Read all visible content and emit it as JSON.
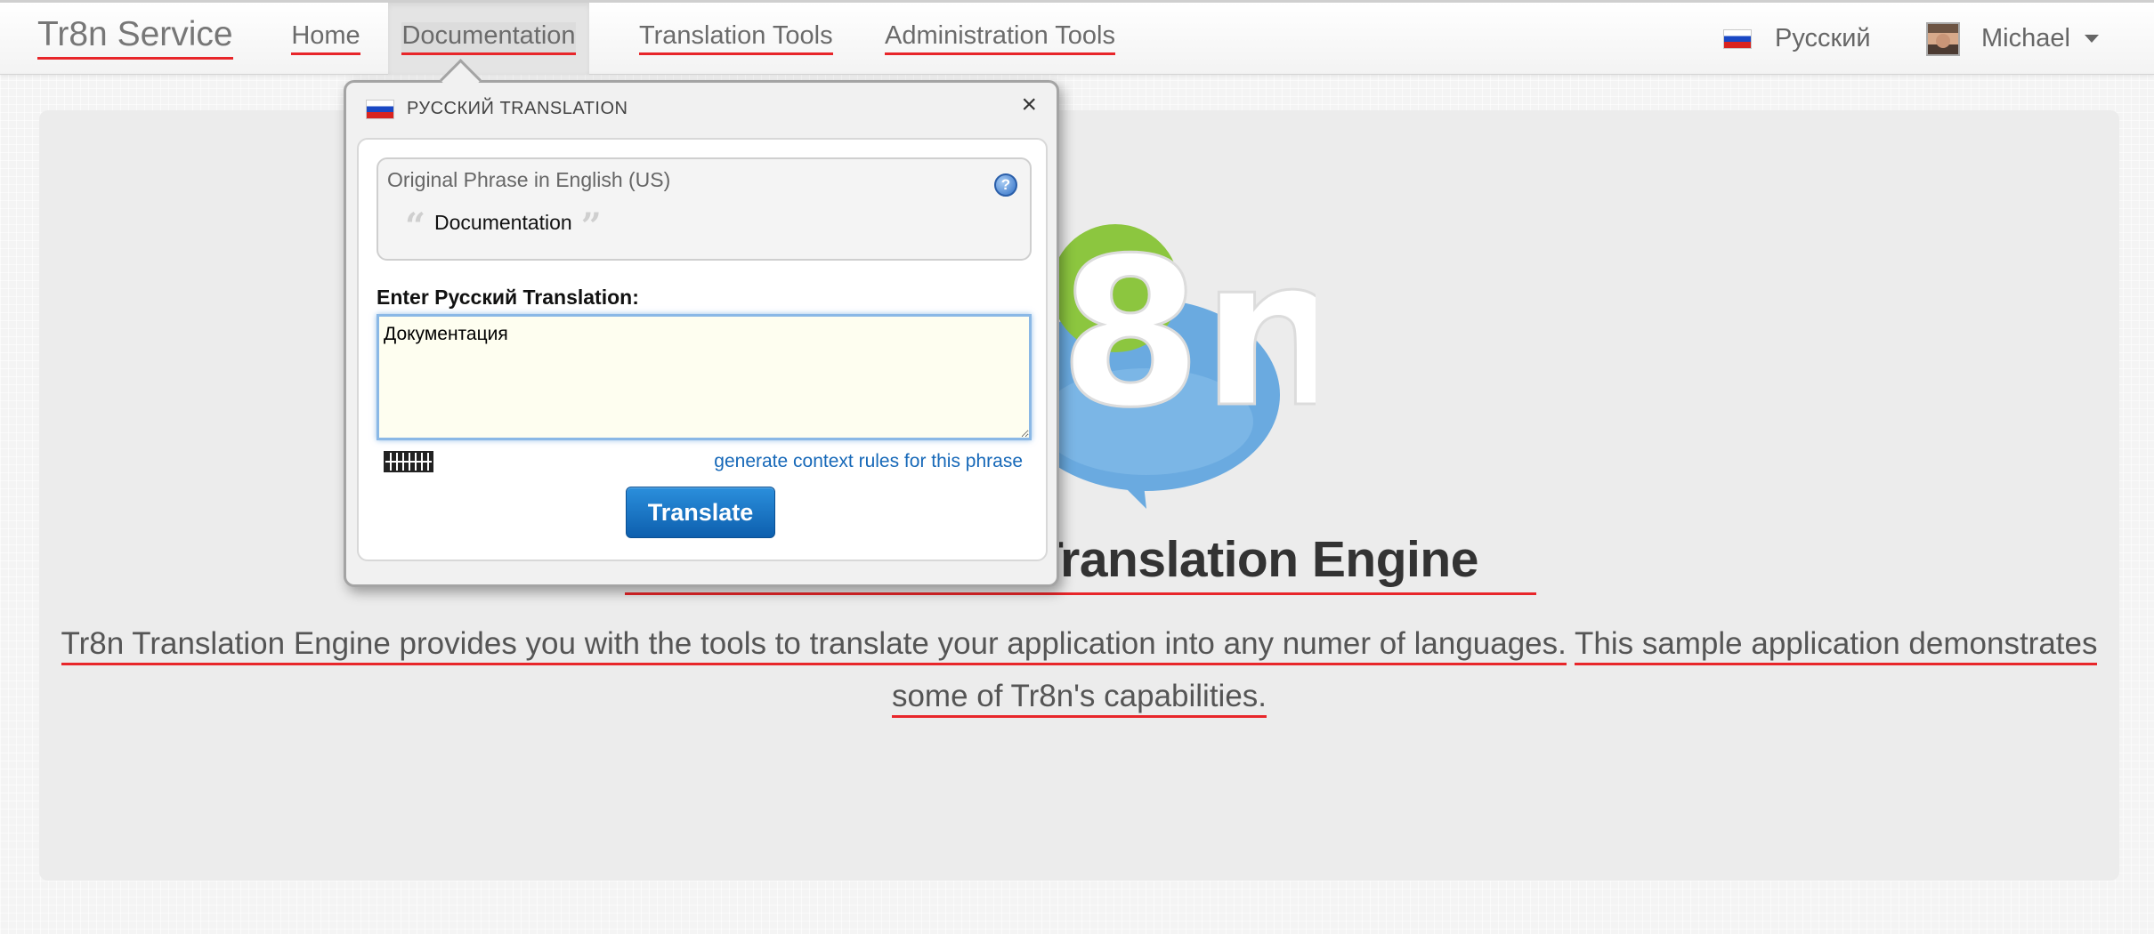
{
  "navbar": {
    "brand": "Tr8n Service",
    "items": [
      {
        "label": "Home"
      },
      {
        "label": "Documentation"
      },
      {
        "label": "Translation Tools"
      },
      {
        "label": "Administration Tools"
      }
    ],
    "language": "Русский",
    "user": "Michael"
  },
  "hero": {
    "logo_text": "8n",
    "title": "Translation Engine",
    "text_part1": "Tr8n Translation Engine provides you with the tools to translate your application into any numer of languages.",
    "text_part2": "This sample application demonstrates some of Tr8n's capabilities."
  },
  "popup": {
    "header": "РУССКИЙ TRANSLATION",
    "close": "×",
    "original_label": "Original Phrase in English (US)",
    "original_phrase": "Documentation",
    "quote_open": "“",
    "quote_close": "”",
    "help": "?",
    "enter_label": "Enter Русский Translation:",
    "translation_value": "Документация",
    "context_link": "generate context rules for this phrase",
    "translate_button": "Translate"
  },
  "colors": {
    "accent_underline": "#e8262a",
    "button_blue": "#1a78c8",
    "link_blue": "#1668b8",
    "logo_green": "#8cc63f",
    "logo_blue": "#6aaae0"
  },
  "icons": [
    "russia-flag-icon",
    "avatar",
    "caret-down-icon",
    "close-icon",
    "help-icon",
    "keyboard-icon",
    "tr8n-logo"
  ]
}
